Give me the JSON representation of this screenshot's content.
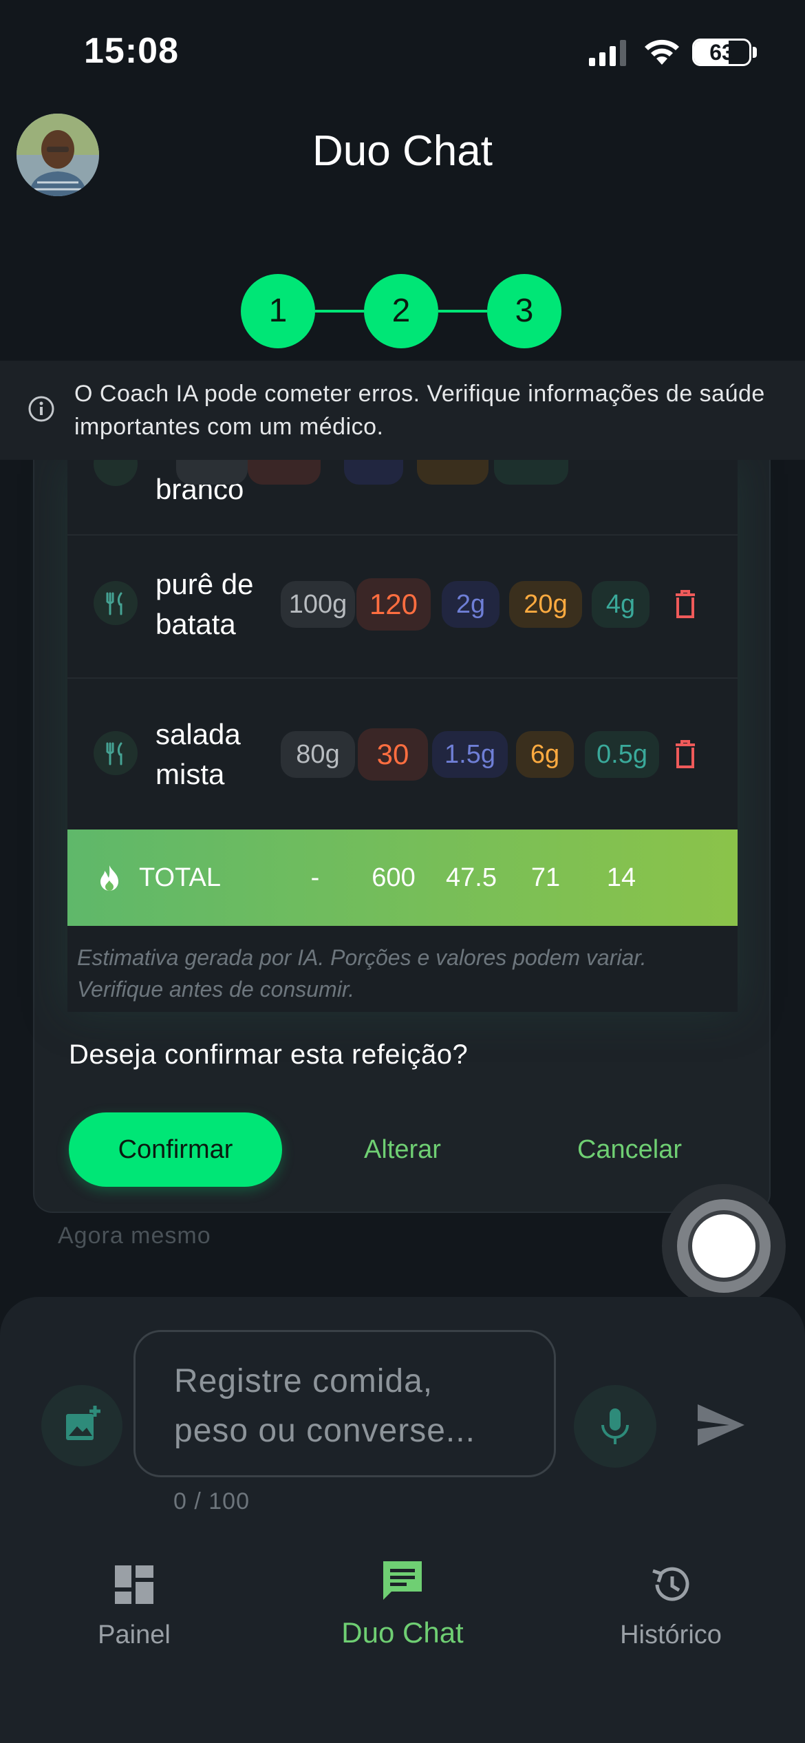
{
  "status_bar": {
    "time": "15:08",
    "battery": "63",
    "battery_level": 0.63
  },
  "header": {
    "title": "Duo Chat",
    "avatar_icon": "user-avatar"
  },
  "stepper": {
    "steps": [
      "1",
      "2",
      "3"
    ]
  },
  "disclaimer": {
    "text": "O Coach IA pode cometer erros. Verifique informações de saúde importantes com um médico.",
    "icon": "info-icon"
  },
  "meal": {
    "items": [
      {
        "name": "branco",
        "portion": "",
        "kcal": "",
        "protein": "",
        "carbs": "",
        "fat": ""
      },
      {
        "name": "purê de batata",
        "portion": "100g",
        "kcal": "120",
        "protein": "2g",
        "carbs": "20g",
        "fat": "4g"
      },
      {
        "name": "salada mista",
        "portion": "80g",
        "kcal": "30",
        "protein": "1.5g",
        "carbs": "6g",
        "fat": "0.5g"
      }
    ],
    "total": {
      "label": "TOTAL",
      "portion": "-",
      "kcal": "600",
      "protein": "47.5",
      "carbs": "71",
      "fat": "14"
    },
    "note": "Estimativa gerada por IA. Porções e valores podem variar. Verifique antes de consumir.",
    "question": "Deseja confirmar esta refeição?",
    "actions": {
      "confirm": "Confirmar",
      "change": "Alterar",
      "cancel": "Cancelar"
    },
    "timestamp": "Agora mesmo"
  },
  "composer": {
    "placeholder": "Registre comida, peso ou converse...",
    "counter": "0 / 100"
  },
  "nav": {
    "items": [
      {
        "label": "Painel",
        "icon": "dashboard-icon"
      },
      {
        "label": "Duo Chat",
        "icon": "chat-icon",
        "active": true
      },
      {
        "label": "Histórico",
        "icon": "history-icon"
      }
    ]
  },
  "colors": {
    "accent": "#00e676",
    "background": "#12171c",
    "kcal": "#ff6e40",
    "protein": "#6f7fd6",
    "carbs": "#ffab40",
    "fat": "#3aa99a"
  }
}
